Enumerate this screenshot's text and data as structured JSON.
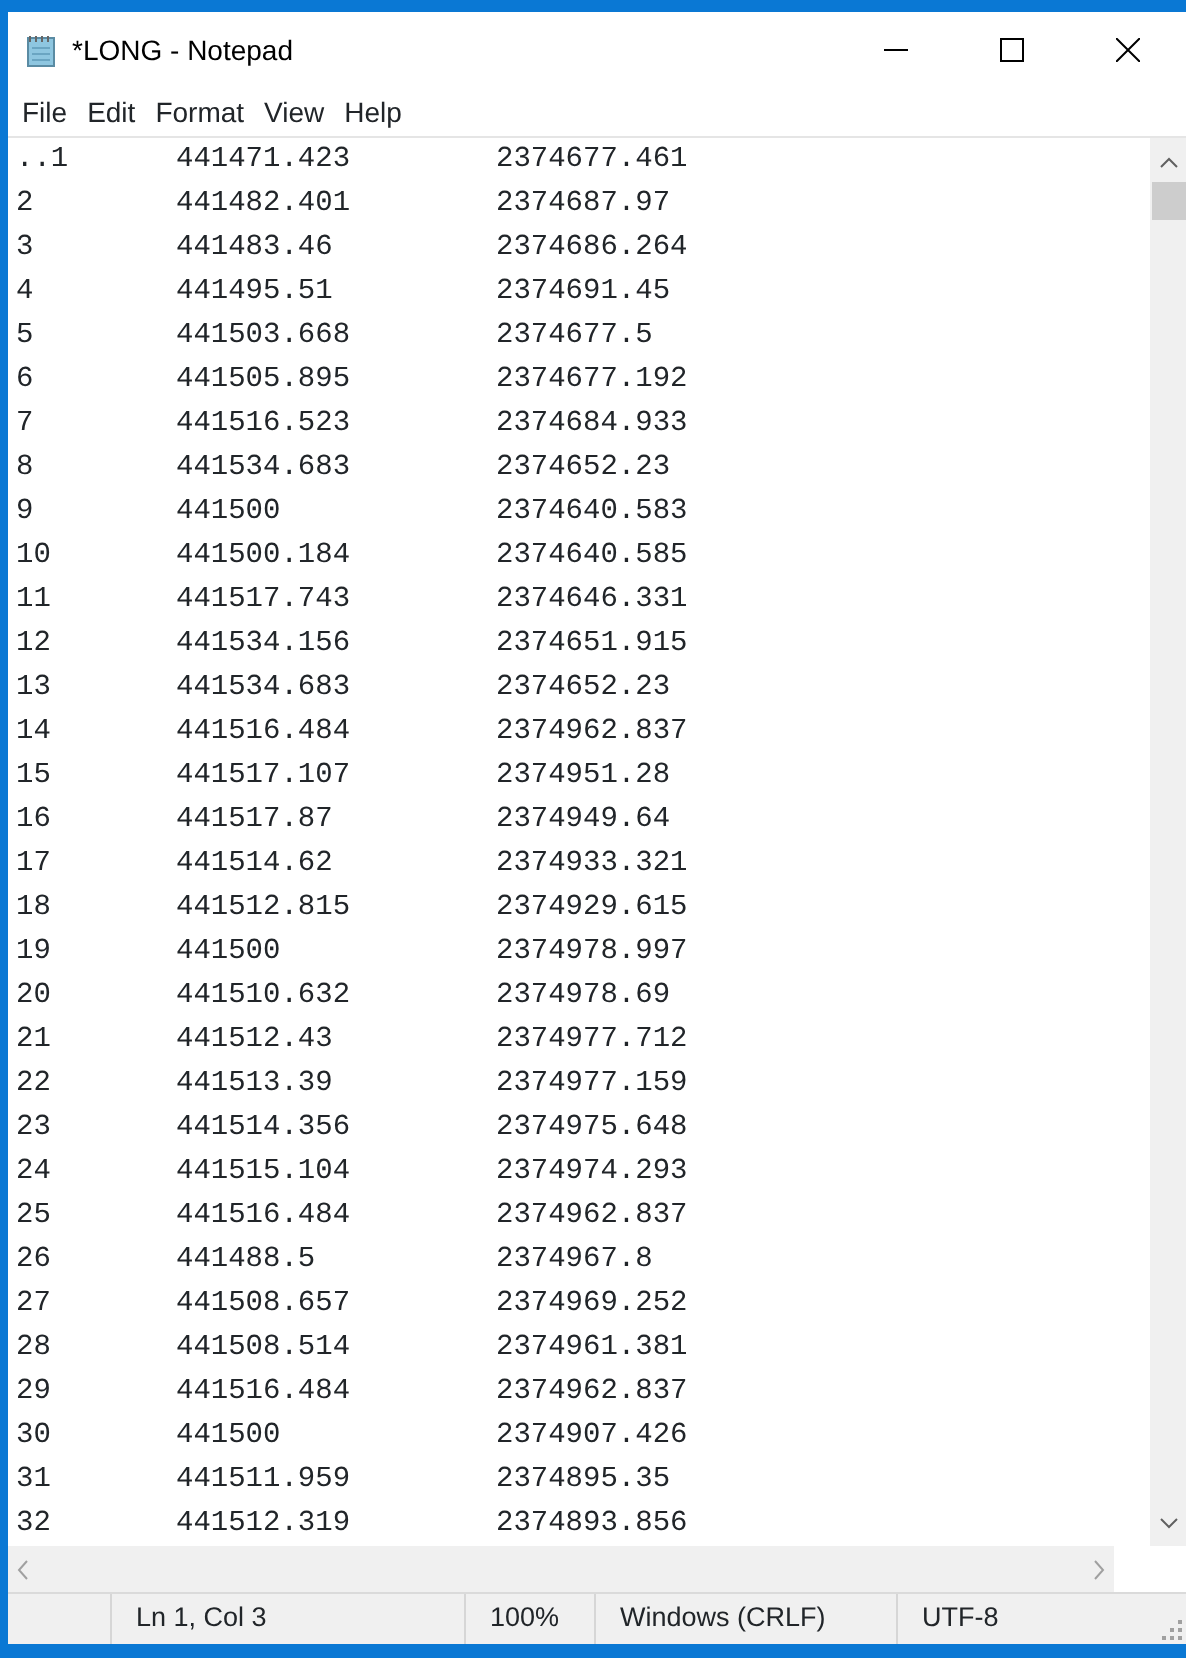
{
  "window": {
    "title": "*LONG - Notepad"
  },
  "menu": [
    "File",
    "Edit",
    "Format",
    "View",
    "Help"
  ],
  "lines": [
    [
      "..1",
      "441471.423",
      "2374677.461"
    ],
    [
      "2",
      "441482.401",
      "2374687.97"
    ],
    [
      "3",
      "441483.46",
      "2374686.264"
    ],
    [
      "4",
      "441495.51",
      "2374691.45"
    ],
    [
      "5",
      "441503.668",
      "2374677.5"
    ],
    [
      "6",
      "441505.895",
      "2374677.192"
    ],
    [
      "7",
      "441516.523",
      "2374684.933"
    ],
    [
      "8",
      "441534.683",
      "2374652.23"
    ],
    [
      "9",
      "441500",
      "2374640.583"
    ],
    [
      "10",
      "441500.184",
      "2374640.585"
    ],
    [
      "11",
      "441517.743",
      "2374646.331"
    ],
    [
      "12",
      "441534.156",
      "2374651.915"
    ],
    [
      "13",
      "441534.683",
      "2374652.23"
    ],
    [
      "14",
      "441516.484",
      "2374962.837"
    ],
    [
      "15",
      "441517.107",
      "2374951.28"
    ],
    [
      "16",
      "441517.87",
      "2374949.64"
    ],
    [
      "17",
      "441514.62",
      "2374933.321"
    ],
    [
      "18",
      "441512.815",
      "2374929.615"
    ],
    [
      "19",
      "441500",
      "2374978.997"
    ],
    [
      "20",
      "441510.632",
      "2374978.69"
    ],
    [
      "21",
      "441512.43",
      "2374977.712"
    ],
    [
      "22",
      "441513.39",
      "2374977.159"
    ],
    [
      "23",
      "441514.356",
      "2374975.648"
    ],
    [
      "24",
      "441515.104",
      "2374974.293"
    ],
    [
      "25",
      "441516.484",
      "2374962.837"
    ],
    [
      "26",
      "441488.5",
      "2374967.8"
    ],
    [
      "27",
      "441508.657",
      "2374969.252"
    ],
    [
      "28",
      "441508.514",
      "2374961.381"
    ],
    [
      "29",
      "441516.484",
      "2374962.837"
    ],
    [
      "30",
      "441500",
      "2374907.426"
    ],
    [
      "31",
      "441511.959",
      "2374895.35"
    ],
    [
      "32",
      "441512.319",
      "2374893.856"
    ]
  ],
  "status_bar": [
    "Ln 1, Col 3",
    "100%",
    "Windows (CRLF)",
    "UTF-8"
  ]
}
